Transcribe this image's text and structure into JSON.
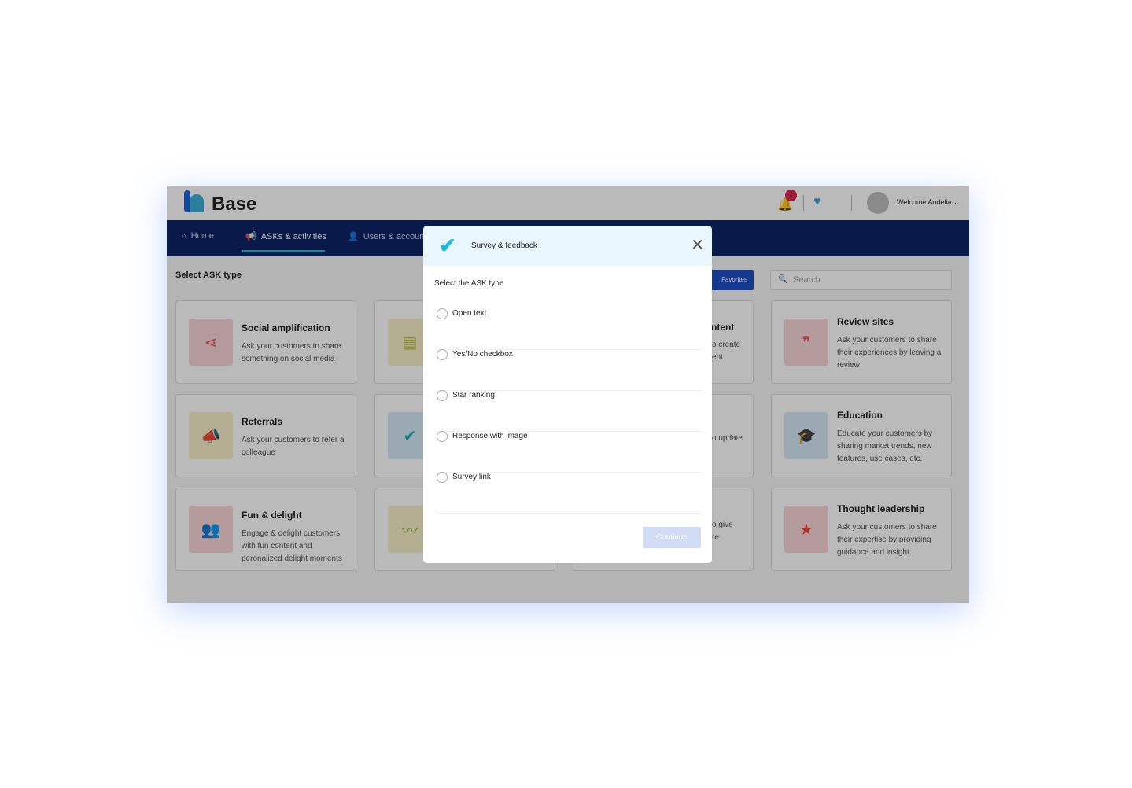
{
  "header": {
    "brand": "Base",
    "notifications": "1",
    "welcome": "Welcome Audelia ⌄"
  },
  "nav": [
    {
      "label": "Home",
      "icon": "home-icon"
    },
    {
      "label": "ASKs & activities",
      "icon": "megaphone-icon"
    },
    {
      "label": "Users & accounts",
      "icon": "user-icon"
    }
  ],
  "page": {
    "heading": "Select ASK type",
    "favorites": "Favorites",
    "search_placeholder": "Search"
  },
  "cards": [
    {
      "title": "Social amplification",
      "desc": "Ask your customers to share something on social media",
      "color": "#f7d4d6"
    },
    {
      "title": "Referrals",
      "desc": "Ask your customers to refer a colleague",
      "color": "#f7f0c8"
    },
    {
      "title": "Fun & delight",
      "desc": "Engage & delight customers with fun content and peronalized delight moments",
      "color": "#f9d5d5"
    },
    {
      "title": "Review sites",
      "desc": "Ask your customers to share their experiences by leaving a review",
      "color": "#f9d5d5"
    },
    {
      "title": "Education",
      "desc": "Educate your customers by sharing market trends, new features, use cases, etc.",
      "color": "#d5e9f5"
    },
    {
      "title": "Thought leadership",
      "desc": "Ask your customers to share their expertise by providing guidance and insight",
      "color": "#f9d5d5"
    }
  ],
  "fragments": {
    "c1t": "ntent",
    "c1a": "o create",
    "c1b": "ent",
    "c2a": "o update",
    "c3a": "o give",
    "c3b": "re"
  },
  "modal": {
    "title": "Survey & feedback",
    "subtitle": "Select the ASK type",
    "options": [
      "Open text",
      "Yes/No checkbox",
      "Star ranking",
      "Response with image",
      "Survey link"
    ],
    "continue": "Continue"
  }
}
